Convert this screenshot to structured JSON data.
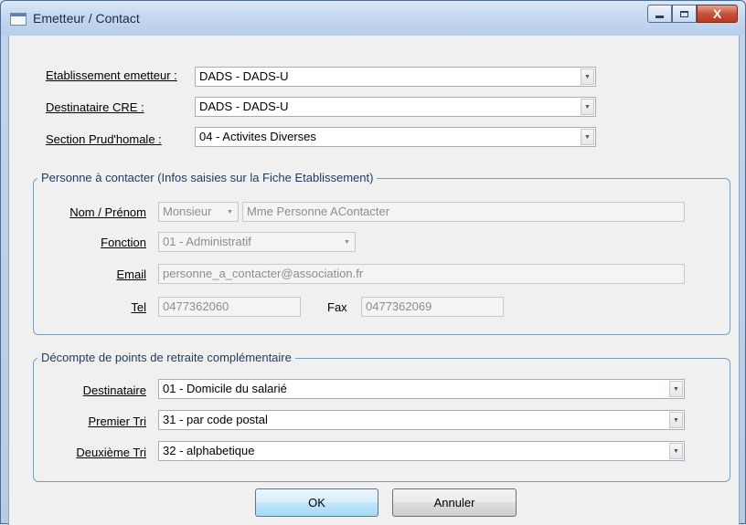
{
  "window": {
    "title": "Emetteur / Contact",
    "close_glyph": "X"
  },
  "header": {
    "etablissement_label": "Etablissement emetteur :",
    "etablissement_value": "DADS - DADS-U",
    "destinataire_cre_label": "Destinataire CRE :",
    "destinataire_cre_value": "DADS - DADS-U",
    "section_label": "Section Prud'homale :",
    "section_value": "04 - Activites Diverses"
  },
  "contact": {
    "group_title": "Personne à contacter (Infos saisies sur la Fiche Etablissement)",
    "nom_label": "Nom / Prénom",
    "civilite_value": "Monsieur",
    "nom_value": "Mme Personne AContacter",
    "fonction_label": "Fonction",
    "fonction_value": "01 - Administratif",
    "email_label": "Email",
    "email_value": "personne_a_contacter@association.fr",
    "tel_label": "Tel",
    "tel_value": "0477362060",
    "fax_label": "Fax",
    "fax_value": "0477362069"
  },
  "points": {
    "group_title": "Décompte de points de retraite complémentaire",
    "destinataire_label": "Destinataire",
    "destinataire_value": "01 - Domicile du salarié",
    "premier_tri_label": "Premier Tri",
    "premier_tri_value": "31 - par code postal",
    "deuxieme_tri_label": "Deuxième Tri",
    "deuxieme_tri_value": "32 - alphabetique"
  },
  "buttons": {
    "ok": "OK",
    "cancel": "Annuler"
  },
  "icons": {
    "dropdown": "▼",
    "app": "window-icon",
    "minimize": "minimize-icon",
    "maximize": "maximize-icon",
    "close": "close-icon"
  }
}
